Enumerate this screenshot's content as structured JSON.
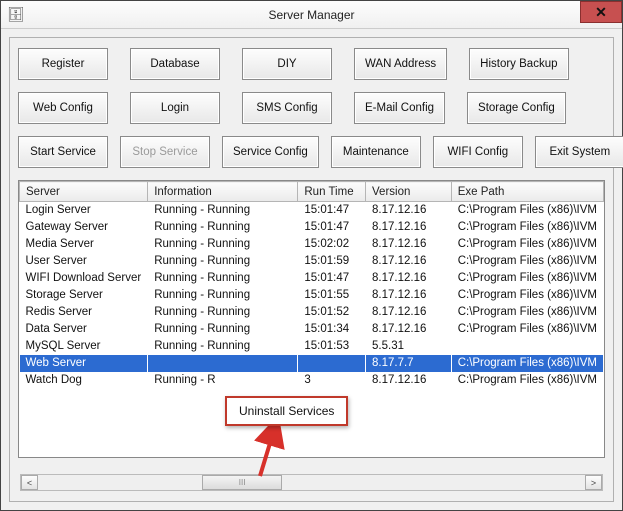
{
  "window": {
    "title": "Server Manager",
    "icon_glyph": "🗄",
    "close_glyph": "✕"
  },
  "buttons_row1": {
    "register": "Register",
    "database": "Database",
    "diy": "DIY",
    "wan": "WAN Address",
    "history": "History Backup"
  },
  "buttons_row2": {
    "webcfg": "Web Config",
    "login": "Login",
    "smscfg": "SMS Config",
    "emailcfg": "E-Mail Config",
    "storagecfg": "Storage Config"
  },
  "buttons_row3": {
    "start": "Start Service",
    "stop": "Stop Service",
    "svccfg": "Service Config",
    "maint": "Maintenance",
    "wificfg": "WIFI Config",
    "exit": "Exit System"
  },
  "table": {
    "headers": {
      "server": "Server",
      "info": "Information",
      "runtime": "Run Time",
      "version": "Version",
      "exepath": "Exe Path"
    },
    "rows": [
      {
        "server": "Login Server",
        "info": "Running - Running",
        "runtime": "15:01:47",
        "version": "8.17.12.16",
        "exepath": "C:\\Program Files (x86)\\IVM"
      },
      {
        "server": "Gateway Server",
        "info": "Running - Running",
        "runtime": "15:01:47",
        "version": "8.17.12.16",
        "exepath": "C:\\Program Files (x86)\\IVM"
      },
      {
        "server": "Media Server",
        "info": "Running - Running",
        "runtime": "15:02:02",
        "version": "8.17.12.16",
        "exepath": "C:\\Program Files (x86)\\IVM"
      },
      {
        "server": "User Server",
        "info": "Running - Running",
        "runtime": "15:01:59",
        "version": "8.17.12.16",
        "exepath": "C:\\Program Files (x86)\\IVM"
      },
      {
        "server": "WIFI Download Server",
        "info": "Running - Running",
        "runtime": "15:01:47",
        "version": "8.17.12.16",
        "exepath": "C:\\Program Files (x86)\\IVM"
      },
      {
        "server": "Storage Server",
        "info": "Running - Running",
        "runtime": "15:01:55",
        "version": "8.17.12.16",
        "exepath": "C:\\Program Files (x86)\\IVM"
      },
      {
        "server": "Redis Server",
        "info": "Running - Running",
        "runtime": "15:01:52",
        "version": "8.17.12.16",
        "exepath": "C:\\Program Files (x86)\\IVM"
      },
      {
        "server": "Data Server",
        "info": "Running - Running",
        "runtime": "15:01:34",
        "version": "8.17.12.16",
        "exepath": "C:\\Program Files (x86)\\IVM"
      },
      {
        "server": "MySQL Server",
        "info": "Running - Running",
        "runtime": "15:01:53",
        "version": "5.5.31",
        "exepath": ""
      },
      {
        "server": "Web Server",
        "info": "",
        "runtime": "",
        "version": "8.17.7.7",
        "exepath": "C:\\Program Files (x86)\\IVM",
        "selected": true
      },
      {
        "server": "Watch Dog",
        "info": "Running - R",
        "runtime": "3",
        "version": "8.17.12.16",
        "exepath": "C:\\Program Files (x86)\\IVM"
      }
    ]
  },
  "context_menu": {
    "uninstall": "Uninstall Services"
  },
  "scroll": {
    "left_glyph": "<",
    "right_glyph": ">",
    "thumb_glyph": "III"
  },
  "annotation": {
    "arrow_color": "#d7302a"
  }
}
